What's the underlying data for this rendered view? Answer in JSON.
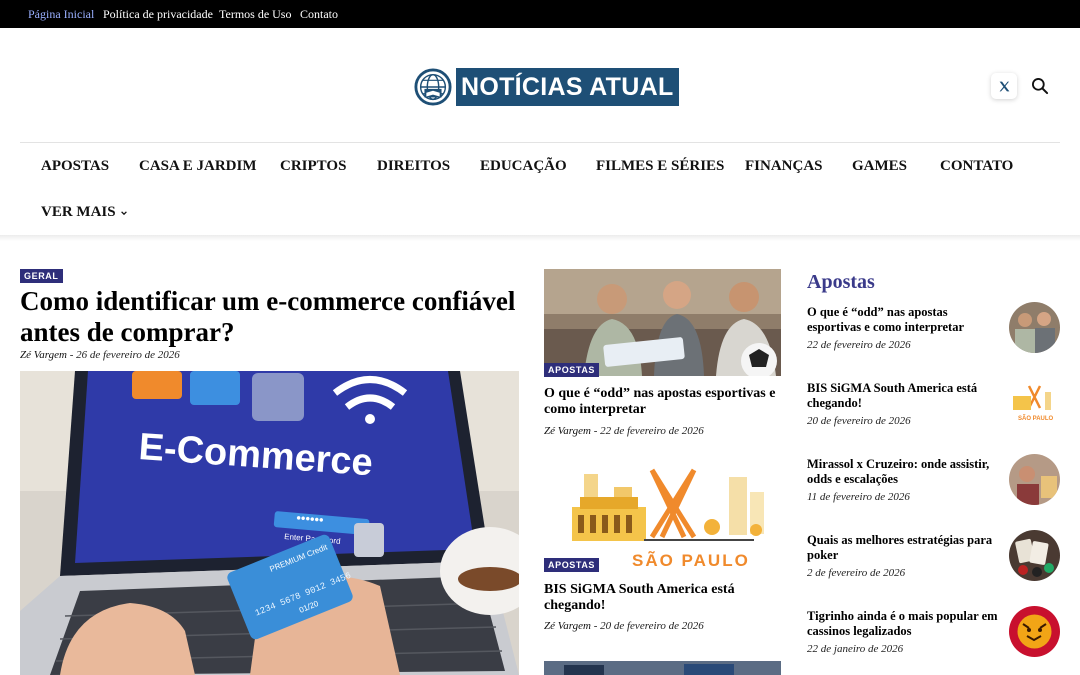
{
  "topbar": {
    "links": [
      "Página Inicial",
      "Política de privacidade",
      "Termos de Uso",
      "Contato"
    ]
  },
  "header": {
    "logo_text": "NOTÍCIAS ATUAL"
  },
  "nav": {
    "items": [
      "APOSTAS",
      "CASA E JARDIM",
      "CRIPTOS",
      "DIREITOS",
      "EDUCAÇÃO",
      "FILMES E SÉRIES",
      "FINANÇAS",
      "GAMES",
      "CONTATO"
    ],
    "more": "VER MAIS"
  },
  "featured": {
    "category": "GERAL",
    "title": "Como identificar um e-commerce confiável antes de comprar?",
    "author": "Zé Vargem",
    "date": " - 26 de fevereiro de 2026",
    "image": {
      "screen_text": "E-Commerce",
      "password_label": "Enter Password",
      "password_dots": "••••••",
      "card_brand": "PREMIUM Credit",
      "card_number": "1234 5678 9012 3456",
      "card_expiry": "01/20"
    }
  },
  "middle": [
    {
      "category": "APOSTAS",
      "title": "O que é “odd” nas apostas esportivas e como interpretar",
      "author": "Zé Vargem",
      "date": " - 22 de fevereiro de 2026"
    },
    {
      "category": "APOSTAS",
      "title": "BIS SiGMA South America está chegando!",
      "author": "Zé Vargem",
      "date": " - 20 de fevereiro de 2026",
      "image_text": "SÃO PAULO"
    }
  ],
  "sidebar": {
    "heading": "Apostas",
    "items": [
      {
        "title": "O que é “odd” nas apostas esportivas e como interpretar",
        "date": "22 de fevereiro de 2026"
      },
      {
        "title": "BIS SiGMA South America está chegando!",
        "date": "20 de fevereiro de 2026"
      },
      {
        "title": "Mirassol x Cruzeiro: onde assistir, odds e escalações",
        "date": "11 de fevereiro de 2026"
      },
      {
        "title": "Quais as melhores estratégias para poker",
        "date": "2 de fevereiro de 2026"
      },
      {
        "title": "Tigrinho ainda é o mais popular em cassinos legalizados",
        "date": "22 de janeiro de 2026"
      }
    ],
    "thumb_image_text": "SÃO PAULO"
  },
  "colors": {
    "topbar_bg": "#000000",
    "active_link": "#9ab0ff",
    "logo_bg": "#1e4f76",
    "badge_bg": "#2e2e7a",
    "sidebar_heading": "#3a3a8a"
  },
  "icons": [
    "globe-logo-icon",
    "x-twitter-icon",
    "search-icon",
    "chevron-down-icon"
  ]
}
